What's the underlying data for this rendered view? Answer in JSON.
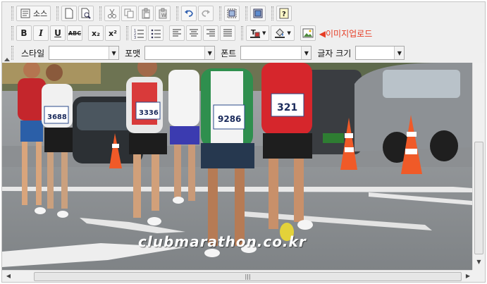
{
  "toolbar": {
    "source_label": "소스",
    "upload_image_label": "◀이미지업로드",
    "style_label": "스타일",
    "format_label": "포맷",
    "font_label": "폰트",
    "font_size_label": "글자 크기",
    "strikethrough_label": "ABC",
    "subscript_label": "x₂",
    "superscript_label": "x²",
    "bold_label": "B",
    "italic_label": "I",
    "underline_label": "U"
  },
  "content": {
    "watermark_text": "clubmarathon.co.kr",
    "bibs": [
      "3336",
      "321",
      "9286",
      "3688"
    ]
  },
  "scrollbar": {
    "grip": "|||"
  },
  "colors": {
    "upload_link": "#e63c24",
    "toolbar_bg": "#efefef"
  }
}
